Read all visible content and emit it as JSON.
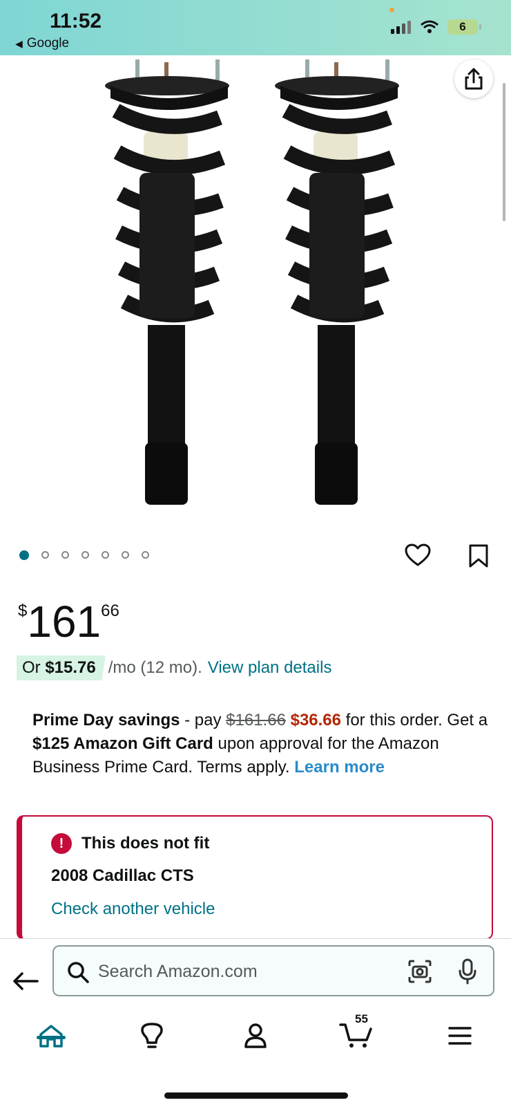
{
  "status_bar": {
    "time": "11:52",
    "back_app": "Google",
    "battery": "6"
  },
  "gallery": {
    "image_count": 7,
    "active_index": 0
  },
  "price": {
    "currency": "$",
    "whole": "161",
    "fraction": "66"
  },
  "monthly": {
    "prefix": "Or ",
    "amount": "$15.76",
    "term": "/mo (12 mo).",
    "link": "View plan details"
  },
  "promo": {
    "title": "Prime Day savings",
    "sep": " - pay ",
    "old_price": "$161.66",
    "new_price": "$36.66",
    "after_price": " for this order. Get a ",
    "gift": "$125 Amazon Gift Card",
    "rest": " upon approval for the Amazon Business Prime Card. Terms apply. ",
    "learn_more": "Learn more"
  },
  "fit": {
    "title": "This does not fit",
    "vehicle": "2008 Cadillac CTS",
    "link": "Check another vehicle"
  },
  "search": {
    "placeholder": "Search Amazon.com"
  },
  "nav": {
    "cart_count": "55"
  },
  "colors": {
    "teal": "#007185",
    "alert_red": "#c40b3a",
    "price_red": "#b12704",
    "link_blue": "#2a8bc9"
  }
}
